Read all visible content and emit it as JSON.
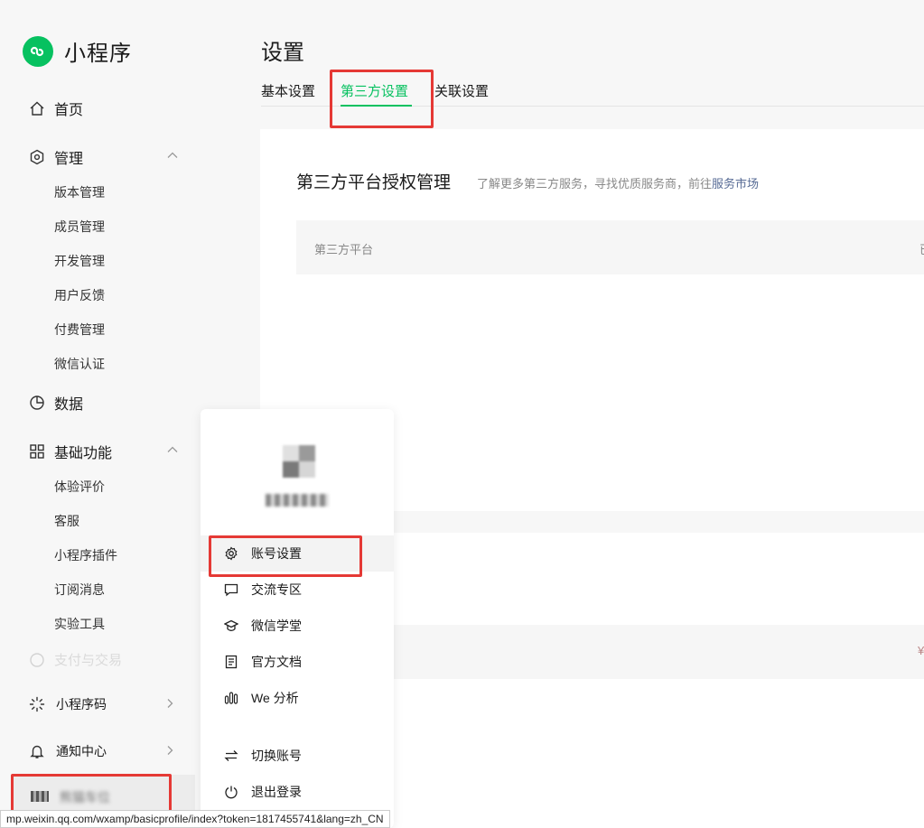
{
  "app": {
    "name": "小程序",
    "brand_color": "#07c160",
    "alert_color": "#e53935",
    "link_color": "#576b95"
  },
  "sidebar": {
    "home": "首页",
    "manage": {
      "label": "管理",
      "items": [
        "版本管理",
        "成员管理",
        "开发管理",
        "用户反馈",
        "付费管理",
        "微信认证"
      ]
    },
    "data": "数据",
    "basic": {
      "label": "基础功能",
      "items": [
        "体验评价",
        "客服",
        "小程序插件",
        "订阅消息",
        "实验工具"
      ]
    },
    "payment": "支付与交易",
    "qrcode": "小程序码",
    "notify": "通知中心",
    "account_name": "熊猫车位"
  },
  "main": {
    "title": "设置",
    "tabs": [
      {
        "label": "基本设置"
      },
      {
        "label": "第三方设置"
      },
      {
        "label": "关联设置"
      }
    ],
    "card": {
      "title": "第三方平台授权管理",
      "desc": "了解更多第三方服务，寻找优质服务商，前往",
      "desc_link": "服务市场",
      "col_platform": "第三方平台",
      "col_right": "已"
    },
    "row2_mark": "¥"
  },
  "popover": {
    "items": [
      {
        "label": "账号设置",
        "icon": "gear-icon"
      },
      {
        "label": "交流专区",
        "icon": "chat-icon"
      },
      {
        "label": "微信学堂",
        "icon": "graduation-cap-icon"
      },
      {
        "label": "官方文档",
        "icon": "document-icon"
      },
      {
        "label": "We 分析",
        "icon": "analytics-icon"
      },
      {
        "label": "切换账号",
        "icon": "switch-icon"
      },
      {
        "label": "退出登录",
        "icon": "power-icon"
      }
    ]
  },
  "statusbar": {
    "url": "mp.weixin.qq.com/wxamp/basicprofile/index?token=1817455741&lang=zh_CN"
  }
}
